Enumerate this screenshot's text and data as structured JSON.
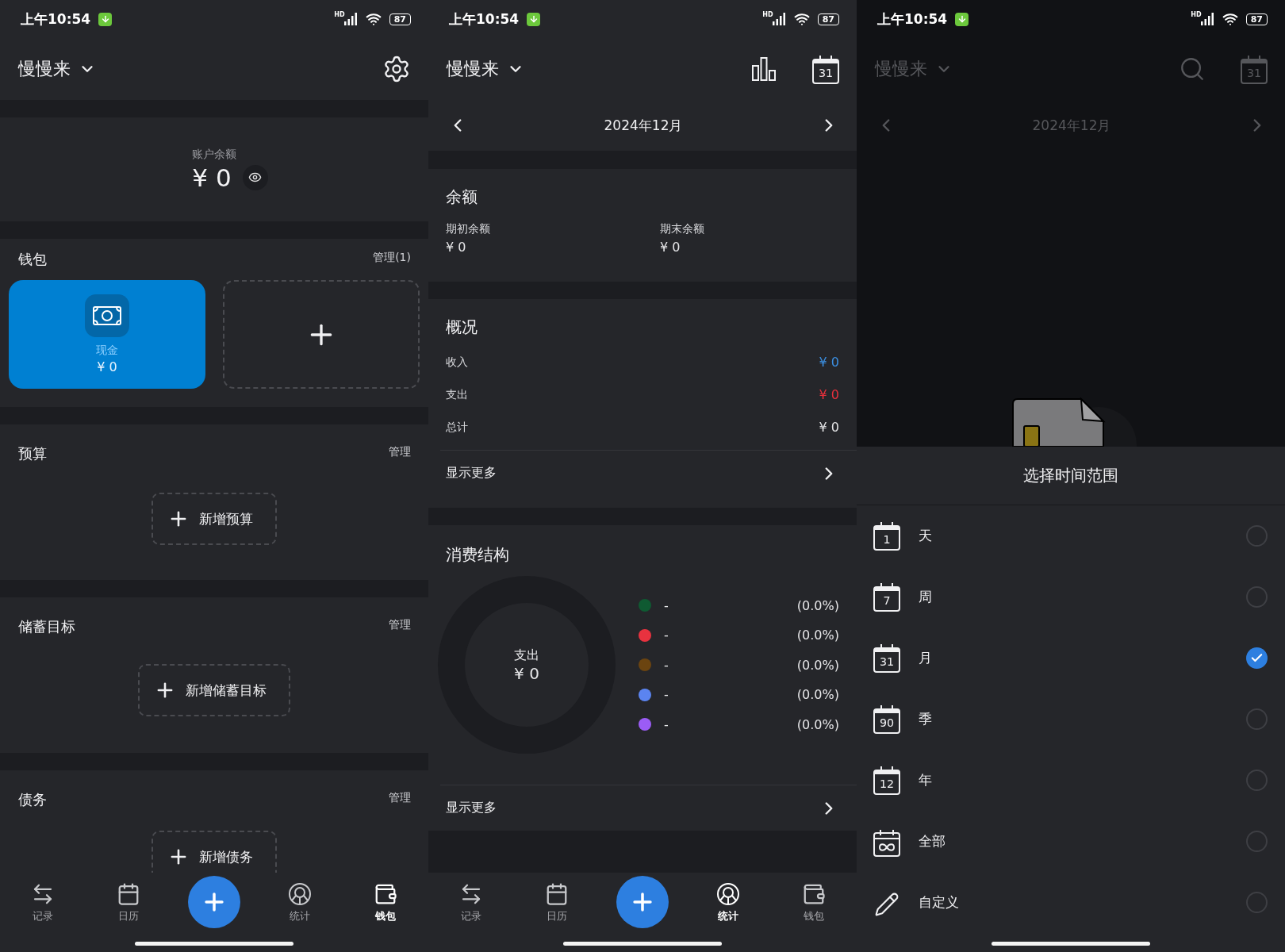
{
  "wallet_screen": {
    "status_bar": {
      "time": "上午10:54",
      "network": "HD",
      "battery": "87"
    },
    "header": {
      "title": "慢慢来"
    },
    "balance": {
      "label": "账户余额",
      "amount": "¥ 0"
    },
    "wallets": {
      "title": "钱包",
      "manage": "管理(1)",
      "cards": [
        {
          "name": "现金",
          "amount": "¥ 0"
        }
      ]
    },
    "sections": [
      {
        "title": "预算",
        "manage": "管理",
        "add_label": "新增预算"
      },
      {
        "title": "储蓄目标",
        "manage": "管理",
        "add_label": "新增储蓄目标"
      },
      {
        "title": "债务",
        "manage": "管理",
        "add_label": "新增债务"
      }
    ],
    "bottom_nav": [
      {
        "kind": "swap",
        "label": "记录",
        "selected": false
      },
      {
        "kind": "calendar",
        "label": "日历",
        "selected": false
      },
      {
        "kind": "add"
      },
      {
        "kind": "stats",
        "label": "统计",
        "selected": false
      },
      {
        "kind": "wallet",
        "label": "钱包",
        "selected": true
      }
    ]
  },
  "report_screen": {
    "status_bar": {
      "time": "上午10:54",
      "network": "HD",
      "battery": "87"
    },
    "header": {
      "title": "慢慢来",
      "calendar_day": "31"
    },
    "period": "2024年12月",
    "balance": {
      "title": "余额",
      "items": [
        {
          "label": "期初余额",
          "value": "¥ 0"
        },
        {
          "label": "期末余额",
          "value": "¥ 0"
        }
      ]
    },
    "overview": {
      "title": "概况",
      "rows": [
        {
          "label": "收入",
          "value": "¥ 0",
          "color": "#3b8fe2"
        },
        {
          "label": "支出",
          "value": "¥ 0",
          "color": "#e8303c"
        },
        {
          "label": "总计",
          "value": "¥ 0",
          "color": "#e4e4e6"
        }
      ],
      "more": "显示更多"
    },
    "structure": {
      "title": "消费结构",
      "center_label": "支出",
      "center_value": "¥ 0",
      "legend": [
        {
          "color": "#0f5a32",
          "label": "-",
          "value": "(0.0%)"
        },
        {
          "color": "#e8323f",
          "label": "-",
          "value": "(0.0%)"
        },
        {
          "color": "#6b4410",
          "label": "-",
          "value": "(0.0%)"
        },
        {
          "color": "#5b84f0",
          "label": "-",
          "value": "(0.0%)"
        },
        {
          "color": "#9b5cf5",
          "label": "-",
          "value": "(0.0%)"
        }
      ],
      "more": "显示更多"
    },
    "bottom_nav": [
      {
        "kind": "swap",
        "label": "记录",
        "selected": false
      },
      {
        "kind": "calendar",
        "label": "日历",
        "selected": false
      },
      {
        "kind": "add"
      },
      {
        "kind": "stats",
        "label": "统计",
        "selected": true
      },
      {
        "kind": "wallet",
        "label": "钱包",
        "selected": false
      }
    ]
  },
  "range_screen": {
    "status_bar": {
      "time": "上午10:54",
      "network": "HD",
      "battery": "87"
    },
    "header": {
      "title": "慢慢来",
      "calendar_day": "31"
    },
    "period": "2024年12月",
    "sheet": {
      "title": "选择时间范围",
      "options": [
        {
          "kind": "calendar",
          "icon_text": "1",
          "label": "天",
          "selected": false
        },
        {
          "kind": "calendar",
          "icon_text": "7",
          "label": "周",
          "selected": false
        },
        {
          "kind": "calendar",
          "icon_text": "31",
          "label": "月",
          "selected": true
        },
        {
          "kind": "calendar",
          "icon_text": "90",
          "label": "季",
          "selected": false
        },
        {
          "kind": "calendar",
          "icon_text": "12",
          "label": "年",
          "selected": false
        },
        {
          "kind": "infinity",
          "label": "全部",
          "selected": false
        },
        {
          "kind": "pencil",
          "label": "自定义",
          "selected": false
        }
      ]
    }
  }
}
